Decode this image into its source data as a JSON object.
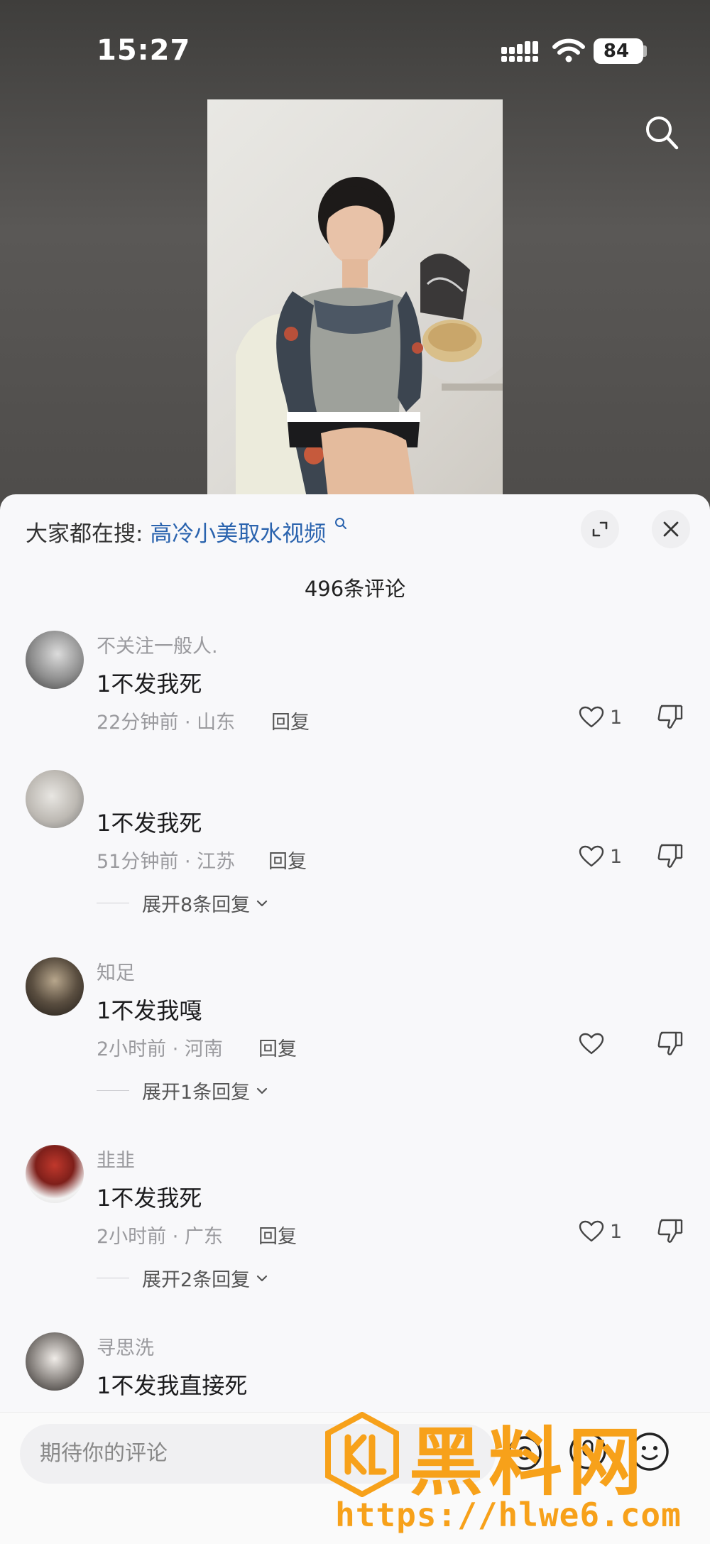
{
  "status_bar": {
    "time": "15:27",
    "battery": "84"
  },
  "search_bar": {
    "label": "大家都在搜:",
    "query": "高冷小美取水视频"
  },
  "comment_count": "496条评论",
  "comments": [
    {
      "username": "不关注一般人.",
      "text": "1不发我死",
      "meta": "22分钟前 · 山东",
      "reply": "回复",
      "likes": "1",
      "expand": ""
    },
    {
      "username": "",
      "text": "1不发我死",
      "meta": "51分钟前 · 江苏",
      "reply": "回复",
      "likes": "1",
      "expand": "展开8条回复"
    },
    {
      "username": "知足",
      "text": "1不发我嘎",
      "meta": "2小时前 · 河南",
      "reply": "回复",
      "likes": "",
      "expand": "展开1条回复"
    },
    {
      "username": "韭韭",
      "text": "1不发我死",
      "meta": "2小时前 · 广东",
      "reply": "回复",
      "likes": "1",
      "expand": "展开2条回复"
    },
    {
      "username": "寻思洗",
      "text": "1不发我直接死",
      "meta": "",
      "reply": "",
      "likes": "",
      "expand": ""
    }
  ],
  "input": {
    "placeholder": "期待你的评论"
  },
  "watermark": {
    "title": "黑料网",
    "url": "https://hlwe6.com"
  },
  "colors": {
    "accent_link": "#2a63ae",
    "watermark": "#f7a11a",
    "sheet_bg": "#f8f8fa"
  },
  "icons": [
    "signal-icon",
    "wifi-icon",
    "search-icon",
    "expand-icon",
    "close-icon",
    "heart-icon",
    "dislike-icon",
    "chevron-down-icon",
    "at-icon",
    "mic-icon",
    "emoji-icon"
  ]
}
